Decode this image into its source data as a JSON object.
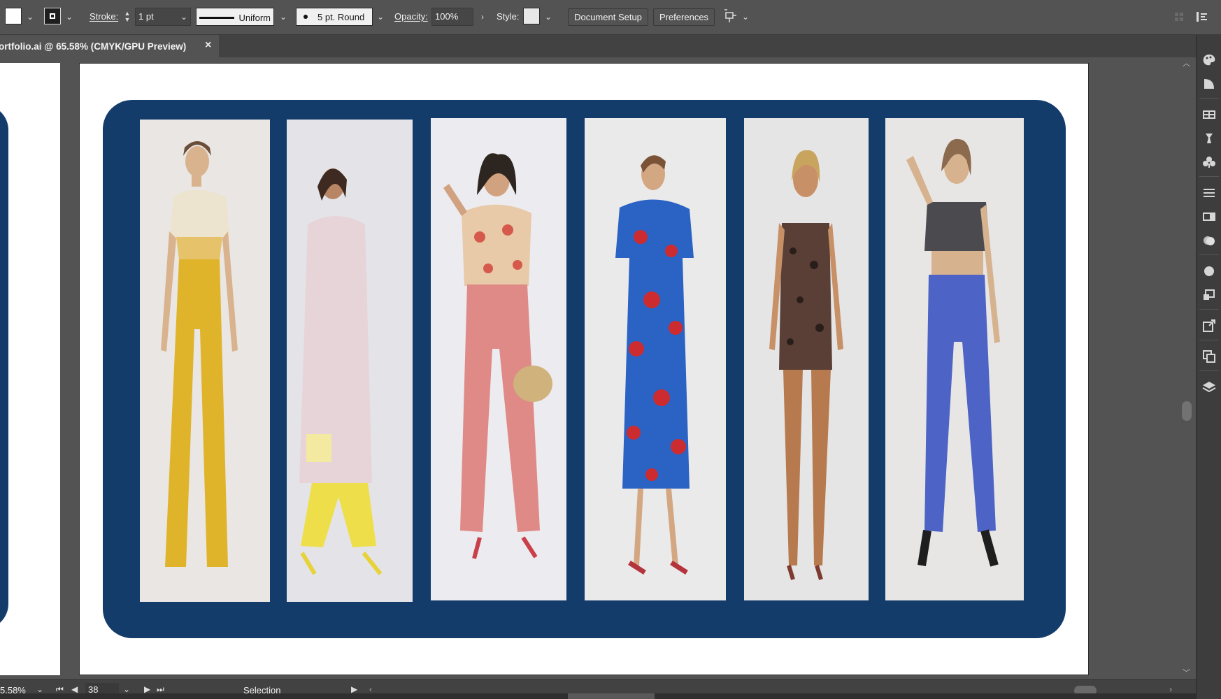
{
  "control_bar": {
    "stroke_label": "Stroke:",
    "stroke_weight": "1 pt",
    "variable_width_profile": "Uniform",
    "brush_definition": "5 pt. Round",
    "opacity_label": "Opacity:",
    "opacity_value": "100%",
    "style_label": "Style:",
    "document_setup_label": "Document Setup",
    "preferences_label": "Preferences"
  },
  "document_tab": {
    "title": "ortfolio.ai @ 65.58% (CMYK/GPU Preview)",
    "close_glyph": "×"
  },
  "status_bar": {
    "zoom": "5.58%",
    "artboard_number": "38",
    "current_tool": "Selection"
  },
  "artboard": {
    "panel_color": "#143c6b",
    "sketches": [
      {
        "name": "figure-yellow-wide-pants",
        "top_color": "#ece4cf",
        "bottom_color": "#e0b42a",
        "skin": "#d9b38e",
        "hair": "#6b4e3a"
      },
      {
        "name": "figure-pink-coat-yellow-pants",
        "top_color": "#e7d4d8",
        "bottom_color": "#e9dce0",
        "skin": "#b98665",
        "hair": "#3e2a20"
      },
      {
        "name": "figure-floral-shirt-red-pants",
        "top_color": "#e8c9a8",
        "bottom_color": "#df8a87",
        "skin": "#d1a27f",
        "hair": "#2d2520"
      },
      {
        "name": "figure-blue-floral-dress",
        "top_color": "#2a63c4",
        "bottom_color": "#2a63c4",
        "skin": "#d4a783",
        "hair": "#7a5236"
      },
      {
        "name": "figure-leopard-bodysuit",
        "top_color": "#5a3f36",
        "bottom_color": "#b77a4e",
        "skin": "#c89066",
        "hair": "#c9a45f"
      },
      {
        "name": "figure-crop-top-blue-jeans",
        "top_color": "#4b4b4f",
        "bottom_color": "#4d63c5",
        "skin": "#d7b28f",
        "hair": "#8c6a4d"
      }
    ]
  }
}
